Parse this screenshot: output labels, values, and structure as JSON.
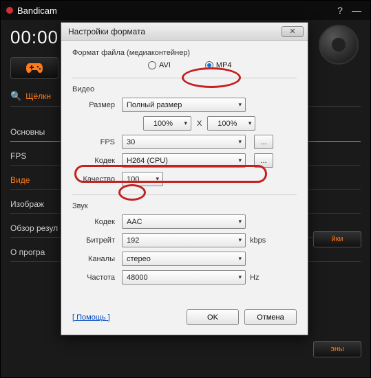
{
  "main": {
    "app_title": "Bandicam",
    "timer": "00:00",
    "search_label": "Щёлкн",
    "nav": [
      "Основны",
      "FPS",
      "Виде",
      "Изображ",
      "Обзор резул",
      "О програ"
    ],
    "btn_settings": "йки",
    "btn_buttons": "эны"
  },
  "dialog": {
    "title": "Настройки формата",
    "format_group": "Формат файла (медиаконтейнер)",
    "format_avi": "AVI",
    "format_mp4": "MP4",
    "video_group": "Видео",
    "size_label": "Размер",
    "size_value": "Полный размер",
    "scale_w": "100%",
    "scale_x": "X",
    "scale_h": "100%",
    "fps_label": "FPS",
    "fps_value": "30",
    "vcodec_label": "Кодек",
    "vcodec_value": "H264 (CPU)",
    "quality_label": "Качество",
    "quality_value": "100",
    "audio_group": "Звук",
    "acodec_label": "Кодек",
    "acodec_value": "AAC",
    "bitrate_label": "Битрейт",
    "bitrate_value": "192",
    "bitrate_unit": "kbps",
    "channels_label": "Каналы",
    "channels_value": "стерео",
    "freq_label": "Частота",
    "freq_value": "48000",
    "freq_unit": "Hz",
    "help": "[ Помощь ]",
    "ok": "OK",
    "cancel": "Отмена",
    "ellipsis": "..."
  }
}
